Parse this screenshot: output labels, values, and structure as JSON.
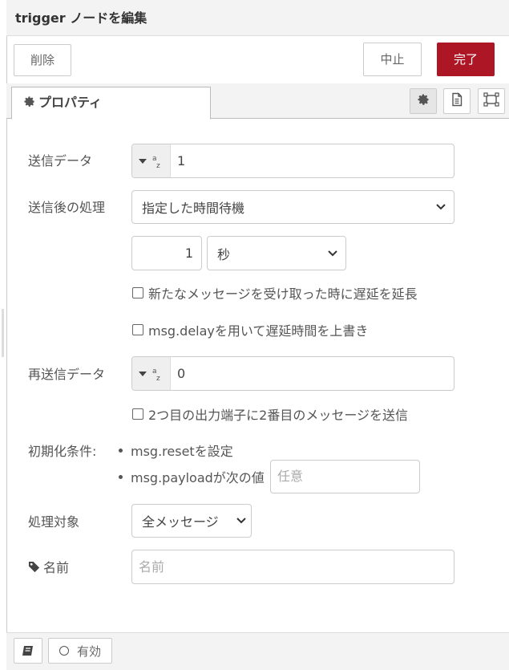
{
  "header": {
    "title": "trigger ノードを編集"
  },
  "toolbar": {
    "delete_label": "削除",
    "cancel_label": "中止",
    "done_label": "完了"
  },
  "tabs": {
    "properties_label": "プロパティ"
  },
  "form": {
    "send_label": "送信データ",
    "send_value": "1",
    "then_label": "送信後の処理",
    "then_value": "指定した時間待機",
    "duration_value": "1",
    "unit_value": "秒",
    "extend_label": "新たなメッセージを受け取った時に遅延を延長",
    "override_label": "msg.delayを用いて遅延時間を上書き",
    "resend_label": "再送信データ",
    "resend_value": "0",
    "second_output_label": "2つ目の出力端子に2番目のメッセージを送信",
    "reset_label": "初期化条件:",
    "reset_items": [
      "msg.resetを設定",
      "msg.payloadが次の値"
    ],
    "reset_placeholder": "任意",
    "handling_label": "処理対象",
    "handling_value": "全メッセージ",
    "name_label": "名前",
    "name_placeholder": "名前"
  },
  "footer": {
    "enabled_label": "有効"
  }
}
